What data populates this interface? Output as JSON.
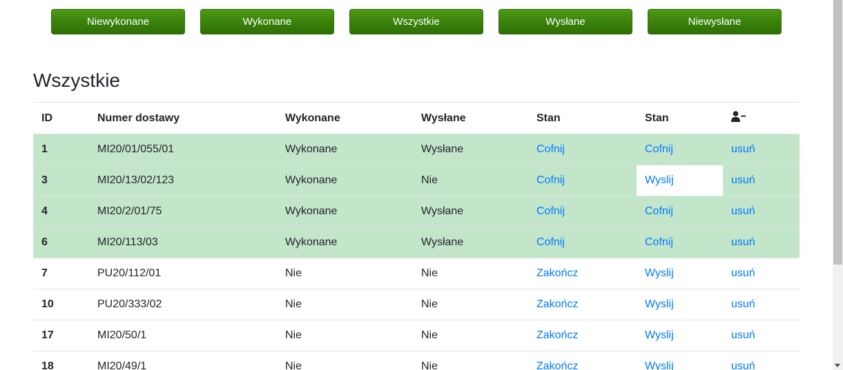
{
  "filters": [
    "Niewykonane",
    "Wykonane",
    "Wszystkie",
    "Wysłane",
    "Niewysłane"
  ],
  "page_title": "Wszystkie",
  "table": {
    "headers": {
      "id": "ID",
      "number": "Numer dostawy",
      "done": "Wykonane",
      "sent": "Wysłane",
      "state1": "Stan",
      "state2": "Stan",
      "action_icon": "user-minus-icon"
    },
    "rows": [
      {
        "id": "1",
        "number": "MI20/01/055/01",
        "done": "Wykonane",
        "sent": "Wysłane",
        "state1": "Cofnij",
        "state2": "Cofnij",
        "action": "usuń",
        "highlight": true,
        "state2_plain": false
      },
      {
        "id": "3",
        "number": "MI20/13/02/123",
        "done": "Wykonane",
        "sent": "Nie",
        "state1": "Cofnij",
        "state2": "Wyslij",
        "action": "usuń",
        "highlight": true,
        "state2_plain": true
      },
      {
        "id": "4",
        "number": "MI20/2/01/75",
        "done": "Wykonane",
        "sent": "Wysłane",
        "state1": "Cofnij",
        "state2": "Cofnij",
        "action": "usuń",
        "highlight": true,
        "state2_plain": false
      },
      {
        "id": "6",
        "number": "MI20/113/03",
        "done": "Wykonane",
        "sent": "Wysłane",
        "state1": "Cofnij",
        "state2": "Cofnij",
        "action": "usuń",
        "highlight": true,
        "state2_plain": false
      },
      {
        "id": "7",
        "number": "PU20/112/01",
        "done": "Nie",
        "sent": "Nie",
        "state1": "Zakończ",
        "state2": "Wyslij",
        "action": "usuń",
        "highlight": false,
        "state2_plain": false
      },
      {
        "id": "10",
        "number": "PU20/333/02",
        "done": "Nie",
        "sent": "Nie",
        "state1": "Zakończ",
        "state2": "Wyslij",
        "action": "usuń",
        "highlight": false,
        "state2_plain": false
      },
      {
        "id": "17",
        "number": "MI20/50/1",
        "done": "Nie",
        "sent": "Nie",
        "state1": "Zakończ",
        "state2": "Wyslij",
        "action": "usuń",
        "highlight": false,
        "state2_plain": false
      },
      {
        "id": "18",
        "number": "MI20/49/1",
        "done": "Nie",
        "sent": "Nie",
        "state1": "Zakończ",
        "state2": "Wyslij",
        "action": "usuń",
        "highlight": false,
        "state2_plain": false
      }
    ]
  },
  "colors": {
    "button_green": "#3a820b",
    "row_success": "#c3e6cb",
    "link": "#007bff"
  }
}
